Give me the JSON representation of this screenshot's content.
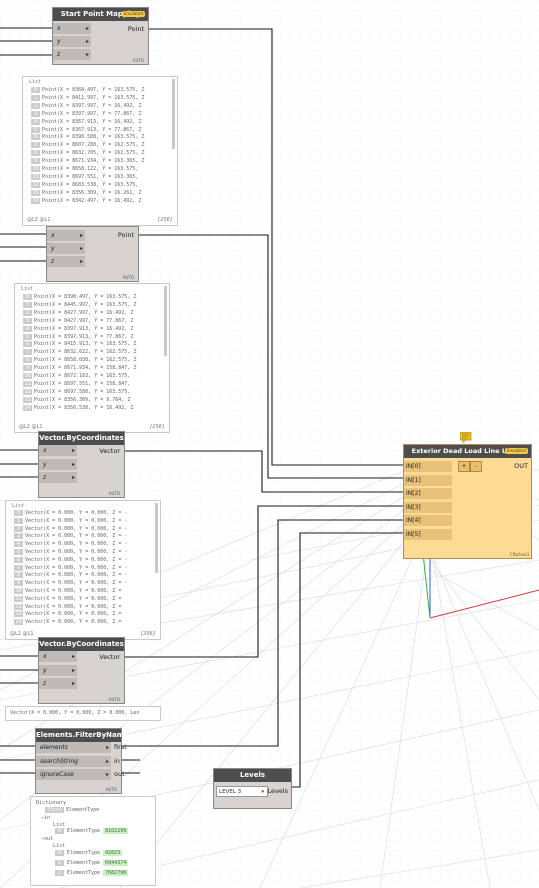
{
  "nodes": {
    "start_point_mapping": {
      "title": "Start Point Mapping",
      "badge": "Emulated",
      "inputs": [
        "x",
        "y",
        "z"
      ],
      "output": "Point",
      "lacing": "AUTO"
    },
    "point2": {
      "title": "",
      "inputs": [
        "x",
        "y",
        "z"
      ],
      "output": "Point",
      "lacing": "AUTO"
    },
    "vector1": {
      "title": "Vector.ByCoordinates",
      "inputs": [
        "x",
        "y",
        "z"
      ],
      "output": "Vector",
      "lacing": "AUTO"
    },
    "vector2": {
      "title": "Vector.ByCoordinates",
      "inputs": [
        "x",
        "y",
        "z"
      ],
      "output": "Vector",
      "lacing": "AUTO"
    },
    "filter": {
      "title": "Elements.FilterByName",
      "inputs": [
        "elements",
        "searchString",
        "ignoreCase"
      ],
      "outputs": [
        "first",
        "in",
        "out"
      ],
      "lacing": "AUTO"
    },
    "levels": {
      "title": "Levels",
      "selected": "LEVEL 3",
      "output": "Levels"
    },
    "exterior": {
      "title": "Exterior Dead Load Line Loads",
      "badge": "Emulated",
      "inputs": [
        "IN[0]",
        "IN[1]",
        "IN[2]",
        "IN[3]",
        "IN[4]",
        "IN[5]"
      ],
      "add": "+",
      "remove": "-",
      "output": "OUT",
      "footer": "CPython3"
    }
  },
  "watch1": {
    "label": "List",
    "rows": [
      "Point(X = 8368.497, Y = 163.575, Z",
      "Point(X = 8411.997, Y = 163.575, Z",
      "Point(X = 8397.997, Y = 16.492, Z",
      "Point(X = 8397.997, Y = 77.867, Z",
      "Point(X = 8367.913, Y = 16.492, Z",
      "Point(X = 8367.913, Y = 77.867, Z",
      "Point(X = 8398.588, Y = 163.575, Z",
      "Point(X = 8607.288, Y = 162.575, Z",
      "Point(X = 8632.705, Y = 162.575, Z",
      "Point(X = 8671.934, Y = 163.365, Z",
      "Point(X = 8658.122, Y = 163.575,",
      "Point(X = 8697.551, Y = 163.365,",
      "Point(X = 8683.538, Y = 163.575,",
      "Point(X = 8356.309, Y = 16.261, Z",
      "Point(X = 8342.497, Y = 16.492, Z"
    ],
    "levels": "@L2 @L1",
    "count": "{256}"
  },
  "watch2": {
    "label": "List",
    "rows": [
      "Point(X = 8398.497, Y = 163.575, Z",
      "Point(X = 8445.997, Y = 163.575, Z",
      "Point(X = 8427.997, Y = 16.492, Z",
      "Point(X = 8427.997, Y = 77.867, Z",
      "Point(X = 8397.913, Y = 16.492, Z",
      "Point(X = 8397.913, Y = 77.867, Z",
      "Point(X = 8415.913, Y = 163.575, Z",
      "Point(X = 8632.622, Y = 162.575, Z",
      "Point(X = 8658.038, Y = 162.575, Z",
      "Point(X = 8671.934, Y = 158.847, Z",
      "Point(X = 8672.163, Y = 163.575,",
      "Point(X = 8697.551, Y = 158.847,",
      "Point(X = 8697.580, Y = 163.575,",
      "Point(X = 8356.309, Y = 9.764, Z",
      "Point(X = 8356.538, Y = 16.492, Z"
    ],
    "levels": "@L2 @L1",
    "count": "{256}"
  },
  "watch3": {
    "label": "List",
    "rows": [
      "Vector(X = 0.000, Y = 0.000, Z = -",
      "Vector(X = 0.000, Y = 0.000, Z = -",
      "Vector(X = 0.000, Y = 0.000, Z = -",
      "Vector(X = 0.000, Y = 0.000, Z = -",
      "Vector(X = 0.000, Y = 0.000, Z = -",
      "Vector(X = 0.000, Y = 0.000, Z = -",
      "Vector(X = 0.000, Y = 0.000, Z = -",
      "Vector(X = 0.000, Y = 0.000, Z = -",
      "Vector(X = 0.000, Y = 0.000, Z = -",
      "Vector(X = 0.000, Y = 0.000, Z = -",
      "Vector(X = 0.000, Y = 0.000, Z =",
      "Vector(X = 0.000, Y = 0.000, Z =",
      "Vector(X = 0.000, Y = 0.000, Z =",
      "Vector(X = 0.000, Y = 0.000, Z =",
      "Vector(X = 0.000, Y = 0.000, Z ="
    ],
    "levels": "@L2 @L1",
    "count": "{256}"
  },
  "preview_vector2": "Vector(X = 0.000, Y = 0.000, Z = 0.000, Len",
  "dictionary": {
    "label": "Dictionary",
    "first_key": "first",
    "first_value": "ElementType",
    "in_key": "in",
    "in_list_label": "List",
    "in_items": [
      {
        "type": "ElementType",
        "id": "8102299"
      }
    ],
    "out_key": "out",
    "out_list_label": "List",
    "out_items": [
      {
        "type": "ElementType",
        "id": "42823"
      },
      {
        "type": "ElementType",
        "id": "6944374"
      },
      {
        "type": "ElementType",
        "id": "7682790"
      }
    ]
  },
  "colors": {
    "node_header": "#4d4d4d",
    "node_body": "#d6d3d1",
    "python_node": "#fddb94",
    "badge": "#f2c94c",
    "grid": "#d9dde2",
    "axis_x": "#d83a3a",
    "axis_y": "#2fb24a",
    "axis_z": "#2d5ce6",
    "wire": "#1a1a1a"
  }
}
